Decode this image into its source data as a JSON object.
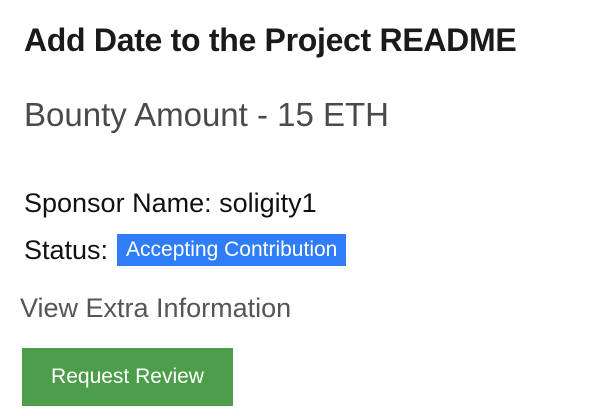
{
  "bounty": {
    "title": "Add Date to the Project README",
    "amount_line": "Bounty Amount - 15 ETH",
    "sponsor_line": "Sponsor Name: soligity1",
    "status_label": "Status:",
    "status_badge": "Accepting Contribution",
    "extra_info_link": "View Extra Information",
    "request_review_label": "Request Review"
  },
  "colors": {
    "badge_bg": "#2f7ef7",
    "button_bg": "#4d9e4b",
    "title_text": "#1a1a1a",
    "muted_text": "#4a4a4a"
  }
}
